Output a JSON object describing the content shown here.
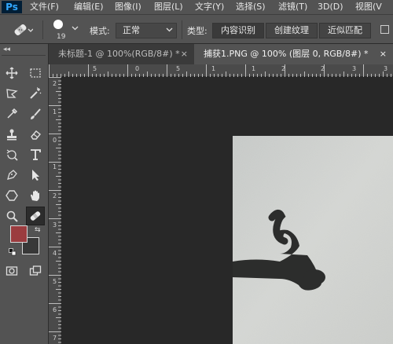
{
  "app": {
    "logo": "Ps"
  },
  "menu": [
    "文件(F)",
    "编辑(E)",
    "图像(I)",
    "图层(L)",
    "文字(Y)",
    "选择(S)",
    "滤镜(T)",
    "3D(D)",
    "视图(V"
  ],
  "options": {
    "brush_size": "19",
    "mode_label": "模式:",
    "mode_value": "正常",
    "type_label": "类型:",
    "type_options": [
      "内容识别",
      "创建纹理",
      "近似匹配"
    ]
  },
  "tabs": [
    {
      "label": "未标题-1 @ 100%(RGB/8#) *",
      "close": "×"
    },
    {
      "label": "捕获1.PNG @ 100% (图层 0, RGB/8#) *",
      "close": "×"
    }
  ],
  "ruler_h": [
    "5",
    "0",
    "5",
    "1",
    "1",
    "2",
    "2",
    "3",
    "3",
    "4",
    "4"
  ],
  "ruler_v": [
    "2",
    "1",
    "0",
    "1",
    "2",
    "3",
    "4",
    "5",
    "6",
    "7"
  ],
  "colors": {
    "foreground": "#9b3c3f",
    "background": "#383838",
    "panel": "#535353",
    "canvas": "#282828"
  },
  "icons": [
    "move-icon",
    "marquee-icon",
    "lasso-icon",
    "magic-wand-icon",
    "eyedropper-icon",
    "brush-icon",
    "stamp-icon",
    "eraser-icon",
    "history-brush-icon",
    "text-icon",
    "pen-icon",
    "path-select-icon",
    "shape-icon",
    "hand-icon",
    "zoom-icon",
    "healing-brush-icon",
    "quick-mask-icon",
    "screen-mode-icon"
  ]
}
